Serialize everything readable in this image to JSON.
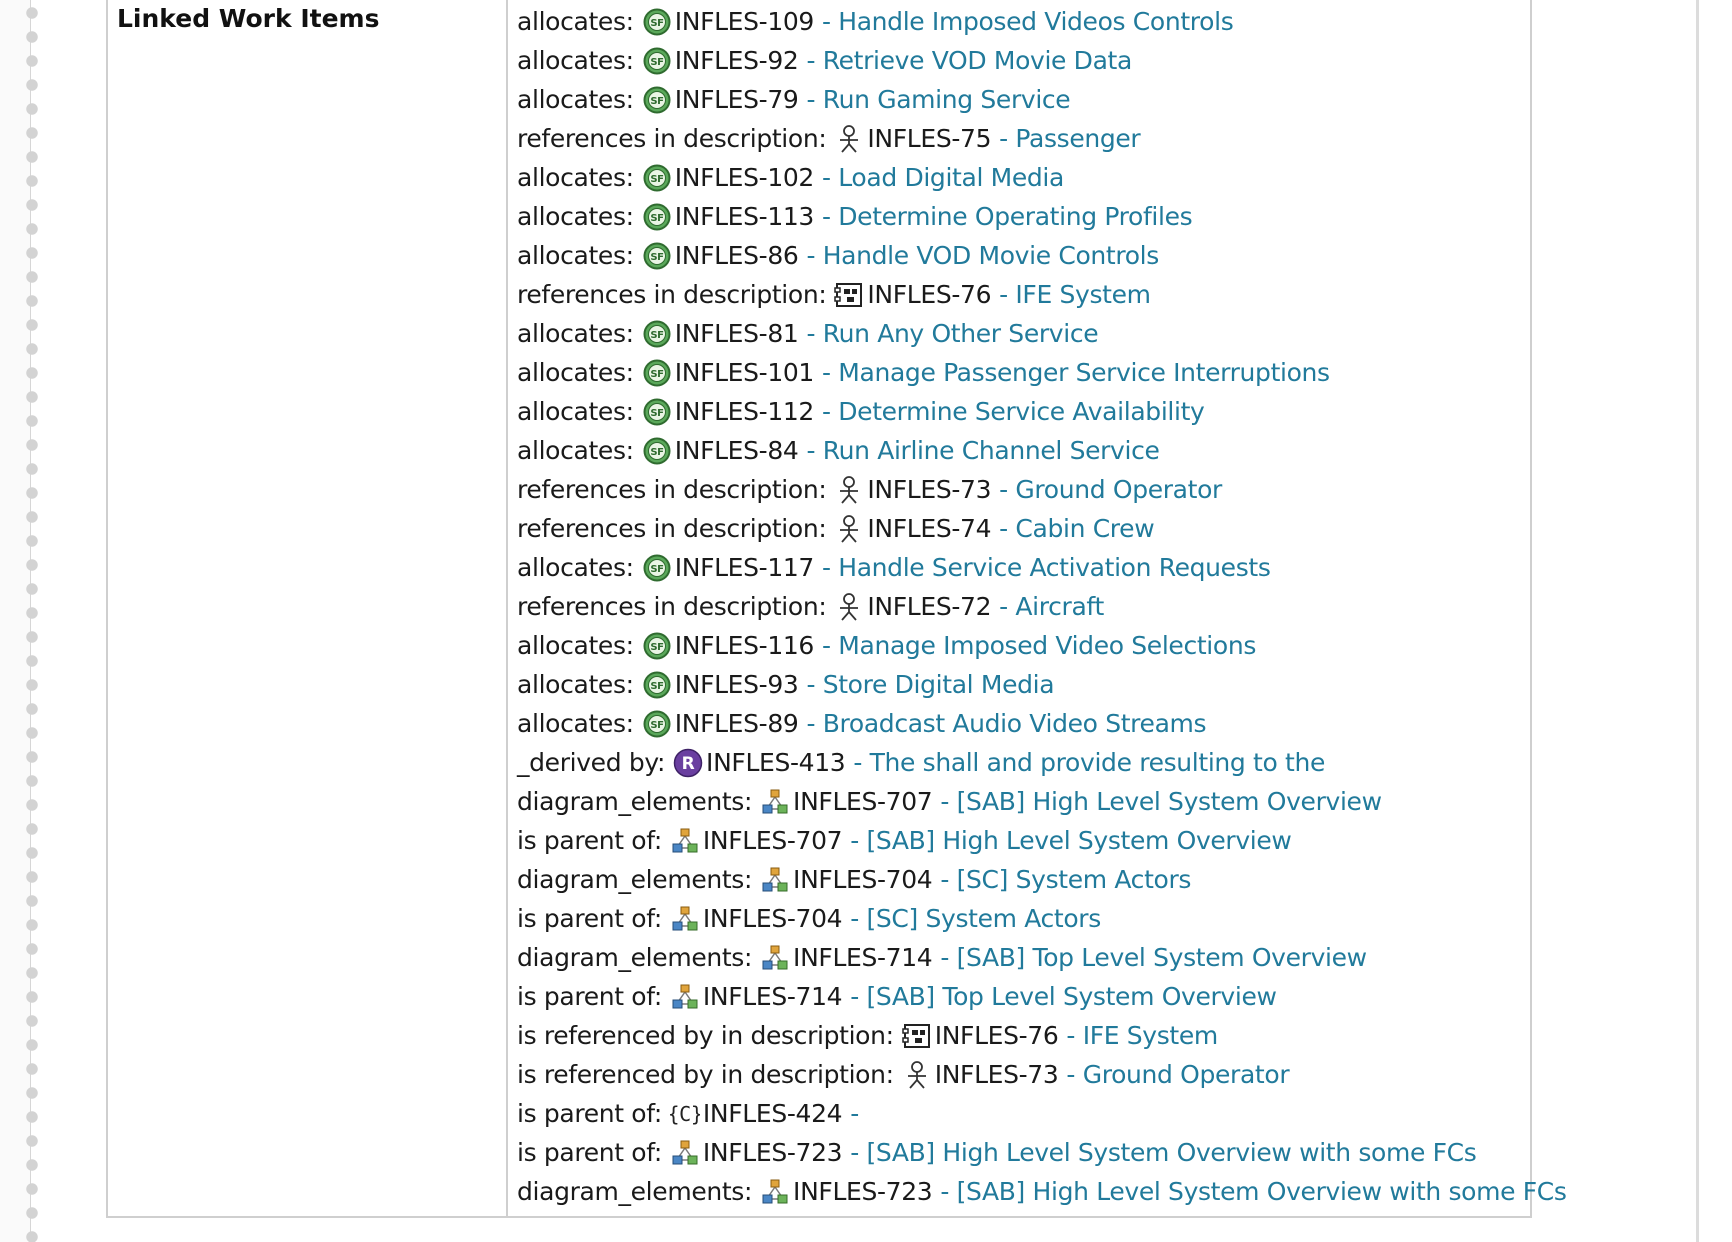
{
  "field_label": "Linked Work Items",
  "colors": {
    "link": "#217a9b",
    "text": "#1a1a1a"
  },
  "links": [
    {
      "role": "allocates:",
      "icon": "system-function-icon",
      "id": "INFLES-109",
      "title": "- Handle Imposed Videos Controls"
    },
    {
      "role": "allocates:",
      "icon": "system-function-icon",
      "id": "INFLES-92",
      "title": "- Retrieve VOD Movie Data"
    },
    {
      "role": "allocates:",
      "icon": "system-function-icon",
      "id": "INFLES-79",
      "title": "- Run Gaming Service"
    },
    {
      "role": "references in description:",
      "icon": "actor-icon",
      "id": "INFLES-75",
      "title": "- Passenger"
    },
    {
      "role": "allocates:",
      "icon": "system-function-icon",
      "id": "INFLES-102",
      "title": "- Load Digital Media"
    },
    {
      "role": "allocates:",
      "icon": "system-function-icon",
      "id": "INFLES-113",
      "title": "- Determine Operating Profiles"
    },
    {
      "role": "allocates:",
      "icon": "system-function-icon",
      "id": "INFLES-86",
      "title": "- Handle VOD Movie Controls"
    },
    {
      "role": "references in description:",
      "icon": "system-component-icon",
      "id": "INFLES-76",
      "title": "- IFE System"
    },
    {
      "role": "allocates:",
      "icon": "system-function-icon",
      "id": "INFLES-81",
      "title": "- Run Any Other Service"
    },
    {
      "role": "allocates:",
      "icon": "system-function-icon",
      "id": "INFLES-101",
      "title": "- Manage Passenger Service Interruptions"
    },
    {
      "role": "allocates:",
      "icon": "system-function-icon",
      "id": "INFLES-112",
      "title": "- Determine Service Availability"
    },
    {
      "role": "allocates:",
      "icon": "system-function-icon",
      "id": "INFLES-84",
      "title": "- Run Airline Channel Service"
    },
    {
      "role": "references in description:",
      "icon": "actor-icon",
      "id": "INFLES-73",
      "title": "- Ground Operator"
    },
    {
      "role": "references in description:",
      "icon": "actor-icon",
      "id": "INFLES-74",
      "title": "- Cabin Crew"
    },
    {
      "role": "allocates:",
      "icon": "system-function-icon",
      "id": "INFLES-117",
      "title": "- Handle Service Activation Requests"
    },
    {
      "role": "references in description:",
      "icon": "actor-icon",
      "id": "INFLES-72",
      "title": "- Aircraft"
    },
    {
      "role": "allocates:",
      "icon": "system-function-icon",
      "id": "INFLES-116",
      "title": "- Manage Imposed Video Selections"
    },
    {
      "role": "allocates:",
      "icon": "system-function-icon",
      "id": "INFLES-93",
      "title": "- Store Digital Media"
    },
    {
      "role": "allocates:",
      "icon": "system-function-icon",
      "id": "INFLES-89",
      "title": "- Broadcast Audio Video Streams"
    },
    {
      "role": "_derived by:",
      "icon": "requirement-icon",
      "id": "INFLES-413",
      "title": "- The shall and provide resulting to the"
    },
    {
      "role": "diagram_elements:",
      "icon": "diagram-icon",
      "id": "INFLES-707",
      "title": "- [SAB] High Level System Overview"
    },
    {
      "role": "is parent of:",
      "icon": "diagram-icon",
      "id": "INFLES-707",
      "title": "- [SAB] High Level System Overview"
    },
    {
      "role": "diagram_elements:",
      "icon": "diagram-icon",
      "id": "INFLES-704",
      "title": "- [SC] System Actors"
    },
    {
      "role": "is parent of:",
      "icon": "diagram-icon",
      "id": "INFLES-704",
      "title": "- [SC] System Actors"
    },
    {
      "role": "diagram_elements:",
      "icon": "diagram-icon",
      "id": "INFLES-714",
      "title": "- [SAB] Top Level System Overview"
    },
    {
      "role": "is parent of:",
      "icon": "diagram-icon",
      "id": "INFLES-714",
      "title": "- [SAB] Top Level System Overview"
    },
    {
      "role": "is referenced by in description:",
      "icon": "system-component-icon",
      "id": "INFLES-76",
      "title": "- IFE System"
    },
    {
      "role": "is referenced by in description:",
      "icon": "actor-icon",
      "id": "INFLES-73",
      "title": "- Ground Operator"
    },
    {
      "role": "is parent of:",
      "icon": "capability-icon",
      "id": "INFLES-424",
      "title": "-"
    },
    {
      "role": "is parent of:",
      "icon": "diagram-icon",
      "id": "INFLES-723",
      "title": "- [SAB] High Level System Overview with some FCs"
    },
    {
      "role": "diagram_elements:",
      "icon": "diagram-icon",
      "id": "INFLES-723",
      "title": "- [SAB] High Level System Overview with some FCs"
    }
  ]
}
